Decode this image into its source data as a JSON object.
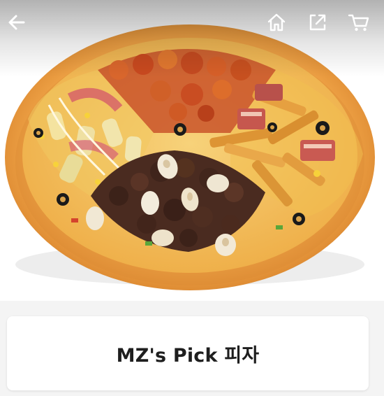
{
  "header": {
    "back_icon": "arrow-left-icon",
    "home_icon": "home-icon",
    "share_icon": "share-icon",
    "cart_icon": "cart-icon"
  },
  "hero": {
    "image_alt": "pizza-image"
  },
  "product": {
    "title": "MZ's Pick 피자"
  },
  "colors": {
    "header_icon": "#ffffff",
    "page_bg": "#f4f4f4",
    "card_bg": "#ffffff",
    "title_text": "#1e1e1e",
    "crust": "#e79a3a",
    "cheese": "#f2b545"
  }
}
